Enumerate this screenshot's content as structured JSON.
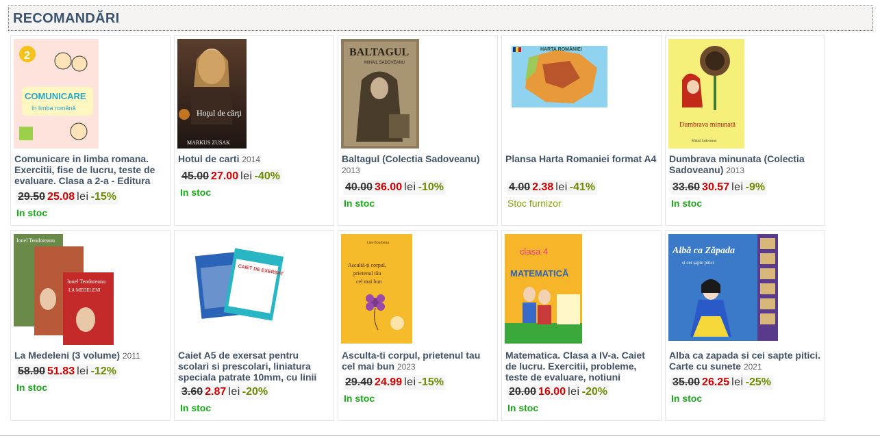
{
  "section_title": "RECOMANDĂRI",
  "currency": "lei",
  "products": [
    {
      "title": "Comunicare in limba romana. Exercitii, fise de lucru, teste de evaluare. Clasa a 2-a - Editura",
      "year": "",
      "old_price": "29.50",
      "new_price": "25.08",
      "discount": "-15%",
      "stock": "In stoc",
      "stock_type": "in",
      "cover_icon": "book-cover-comunicare",
      "cover_text": "COMUNICARE",
      "cover_sub": "în limba română"
    },
    {
      "title": "Hotul de carti",
      "year": "2014",
      "old_price": "45.00",
      "new_price": "27.00",
      "discount": "-40%",
      "stock": "In stoc",
      "stock_type": "in",
      "cover_icon": "book-cover-hotul-de-carti",
      "cover_text": "Hoţul de cărţi",
      "cover_sub": "MARKUS ZUSAK"
    },
    {
      "title": "Baltagul (Colectia Sadoveanu)",
      "year": "2013",
      "old_price": "40.00",
      "new_price": "36.00",
      "discount": "-10%",
      "stock": "In stoc",
      "stock_type": "in",
      "cover_icon": "book-cover-baltagul",
      "cover_text": "BALTAGUL",
      "cover_sub": "MIHAIL SADOVEANU"
    },
    {
      "title": "Plansa Harta Romaniei format A4",
      "year": "",
      "old_price": "4.00",
      "new_price": "2.38",
      "discount": "-41%",
      "stock": "Stoc furnizor",
      "stock_type": "furnizor",
      "cover_icon": "map-of-romania",
      "cover_text": "HARTA ROMÂNIEI",
      "cover_sub": ""
    },
    {
      "title": "Dumbrava minunata (Colectia Sadoveanu)",
      "year": "2013",
      "old_price": "33.60",
      "new_price": "30.57",
      "discount": "-9%",
      "stock": "In stoc",
      "stock_type": "in",
      "cover_icon": "book-cover-dumbrava-minunata",
      "cover_text": "Dumbrava minunată",
      "cover_sub": "Mihail Sadoveanu"
    },
    {
      "title": "La Medeleni (3 volume)",
      "year": "2011",
      "old_price": "58.90",
      "new_price": "51.83",
      "discount": "-12%",
      "stock": "In stoc",
      "stock_type": "in",
      "cover_icon": "book-cover-la-medeleni",
      "cover_text": "LA MEDELENI",
      "cover_sub": "Ionel Teodoreanu"
    },
    {
      "title": "Caiet A5 de exersat pentru scolari si prescolari, liniatura speciala patrate 10mm, cu linii",
      "year": "",
      "old_price": "3.60",
      "new_price": "2.87",
      "discount": "-20%",
      "stock": "In stoc",
      "stock_type": "in",
      "cover_icon": "notebook-covers",
      "cover_text": "CAIET DE EXERSAT",
      "cover_sub": ""
    },
    {
      "title": "Asculta-ti corpul, prietenul tau cel mai bun",
      "year": "2023",
      "old_price": "29.40",
      "new_price": "24.99",
      "discount": "-15%",
      "stock": "In stoc",
      "stock_type": "in",
      "cover_icon": "book-cover-asculta-ti-corpul",
      "cover_text": "Ascultă-ți corpul, prietenul tău cel mai bun",
      "cover_sub": "Lise Bourbeau"
    },
    {
      "title": "Matematica. Clasa a IV-a. Caiet de lucru. Exercitii, probleme, teste de evaluare, notiuni",
      "year": "",
      "old_price": "20.00",
      "new_price": "16.00",
      "discount": "-20%",
      "stock": "In stoc",
      "stock_type": "in",
      "cover_icon": "book-cover-matematica",
      "cover_text": "MATEMATICĂ",
      "cover_sub": "clasa 4"
    },
    {
      "title": "Alba ca zapada si cei sapte pitici. Carte cu sunete",
      "year": "2021",
      "old_price": "35.00",
      "new_price": "26.25",
      "discount": "-25%",
      "stock": "In stoc",
      "stock_type": "in",
      "cover_icon": "book-cover-alba-ca-zapada",
      "cover_text": "Albă ca Zăpada",
      "cover_sub": "și cei șapte pitici"
    }
  ]
}
